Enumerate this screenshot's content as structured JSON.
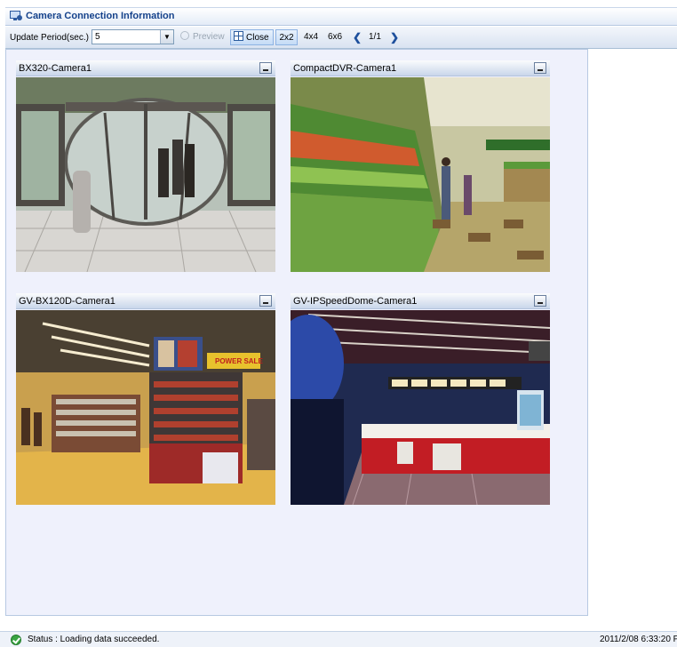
{
  "window": {
    "title": "Camera Connection Information",
    "icon": "camera-monitor-icon"
  },
  "toolbar": {
    "update_period_label": "Update Period(sec.)",
    "update_period_value": "5",
    "preview_label": "Preview",
    "close_label": "Close",
    "layout_options": [
      "2x2",
      "4x4",
      "6x6"
    ],
    "selected_layout": "2x2",
    "page_indicator": "1/1"
  },
  "cameras": [
    {
      "name": "BX320-Camera1",
      "scene": "revolving-door-entrance"
    },
    {
      "name": "CompactDVR-Camera1",
      "scene": "supermarket-produce-aisle"
    },
    {
      "name": "GV-BX120D-Camera1",
      "scene": "video-store-interior",
      "sign_text": "POWER SALE"
    },
    {
      "name": "GV-IPSpeedDome-Camera1",
      "scene": "cinema-concession-counter"
    }
  ],
  "status": {
    "text": "Status : Loading data succeeded.",
    "timestamp": "2011/2/08 6:33:20 P",
    "icon": "success-check-icon"
  }
}
